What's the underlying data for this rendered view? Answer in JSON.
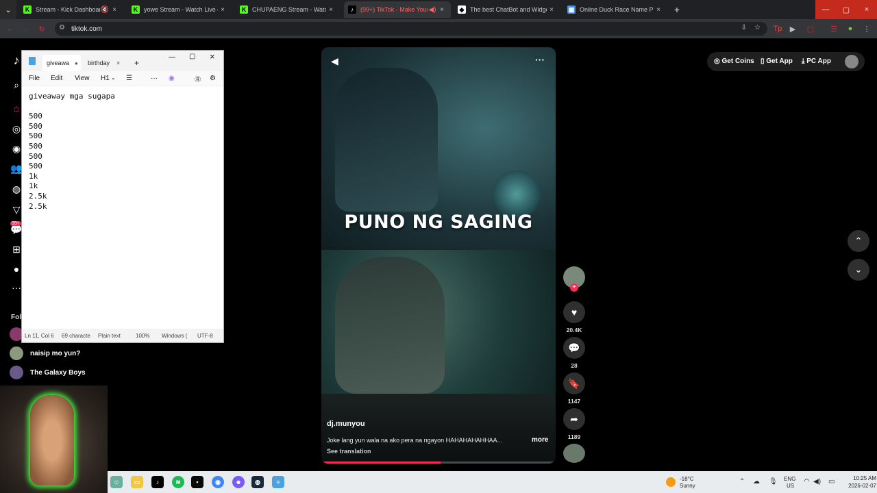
{
  "browser": {
    "tabs": [
      {
        "title": "Stream - Kick Dashboard",
        "favicon": "K",
        "color": "#53fc18",
        "muted": true
      },
      {
        "title": "yowe Stream - Watch Live on K",
        "favicon": "K",
        "color": "#53fc18"
      },
      {
        "title": "CHUPAENG Stream - Watch Liv",
        "favicon": "K",
        "color": "#53fc18"
      },
      {
        "title": "(99+) TikTok - Make Your D",
        "favicon": "♪",
        "color": "#000000",
        "active": true
      },
      {
        "title": "The best ChatBot and Widgets",
        "favicon": "◆",
        "color": "#ffffff"
      },
      {
        "title": "Online Duck Race Name Picke",
        "favicon": "▦",
        "color": "#4a90d9"
      }
    ],
    "url": "tiktok.com"
  },
  "notepad": {
    "tabs": [
      "giveawa",
      "birthday"
    ],
    "menu": [
      "File",
      "Edit",
      "View",
      "H1"
    ],
    "lines": [
      "giveaway mga sugapa",
      "",
      "500",
      "500",
      "500",
      "500",
      "500",
      "500",
      "1k",
      "1k",
      "2.5k",
      "2.5k"
    ],
    "status": {
      "position": "Ln 11, Col 6",
      "chars": "69 characte",
      "format": "Plain text",
      "zoom": "100%",
      "eol": "Windows (",
      "encoding": "UTF-8"
    }
  },
  "sidebar": {
    "following_label": "Foll",
    "accounts": [
      "naisip mo yun?",
      "The Galaxy Boys"
    ],
    "badge": "99+"
  },
  "header": {
    "get_coins": "Get Coins",
    "get_app": "Get App",
    "pc_app": "PC App"
  },
  "video": {
    "caption_overlay": "PUNO NG SAGING",
    "author": "dj.munyou",
    "description": "Joke lang yun wala na ako pera na ngayon HAHAHAHAHHAA...",
    "more": "more",
    "see_translation": "See translation",
    "progress": 0.51
  },
  "actions": {
    "likes": "20.4K",
    "comments": "28",
    "saves": "1147",
    "shares": "1189"
  },
  "taskbar": {
    "weather_temp": "-18°C",
    "weather_text": "Sunny",
    "lang": "ENG",
    "region": "US",
    "time": "10:25 AM",
    "date": "2026-02-07"
  }
}
